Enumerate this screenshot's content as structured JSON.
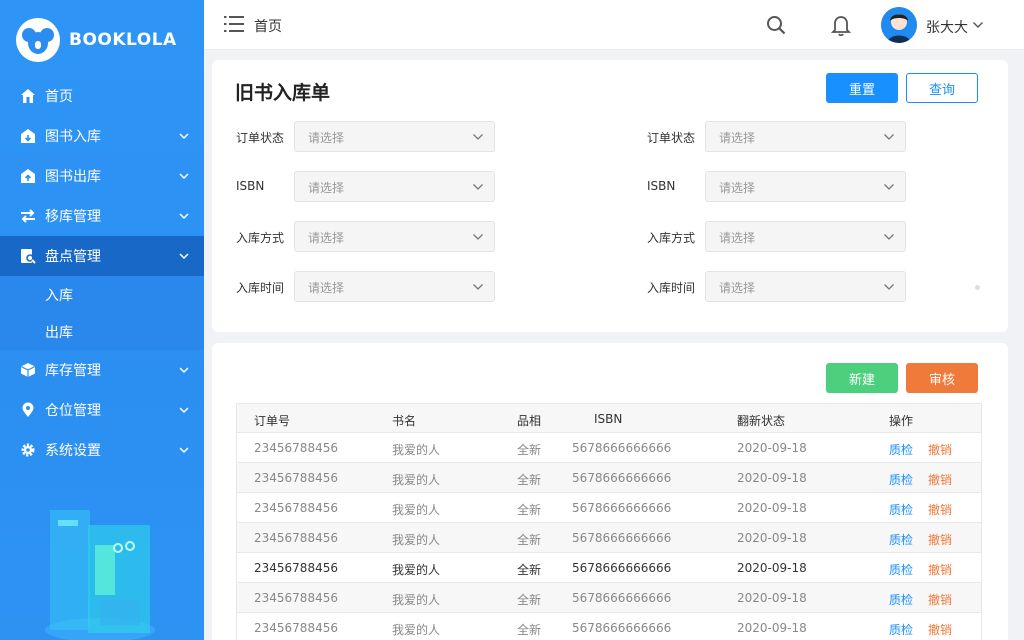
{
  "app": {
    "logo_text": "BOOKLOLA"
  },
  "sidebar": {
    "items": [
      {
        "label": "首页",
        "icon": "home-icon"
      },
      {
        "label": "图书入库",
        "icon": "inbound-icon"
      },
      {
        "label": "图书出库",
        "icon": "outbound-icon"
      },
      {
        "label": "移库管理",
        "icon": "transfer-icon"
      },
      {
        "label": "盘点管理",
        "icon": "inventory-check-icon",
        "active": true
      },
      {
        "label": "库存管理",
        "icon": "box-icon"
      },
      {
        "label": "仓位管理",
        "icon": "location-icon"
      },
      {
        "label": "系统设置",
        "icon": "gear-icon"
      }
    ],
    "submenu": [
      {
        "label": "入库"
      },
      {
        "label": "出库"
      }
    ]
  },
  "topbar": {
    "breadcrumb": "首页",
    "username": "张大大"
  },
  "filter": {
    "title": "旧书入库单",
    "reset_label": "重置",
    "query_label": "查询",
    "fields_left": [
      {
        "label": "订单状态",
        "placeholder": "请选择"
      },
      {
        "label": "ISBN",
        "placeholder": "请选择"
      },
      {
        "label": "入库方式",
        "placeholder": "请选择"
      },
      {
        "label": "入库时间",
        "placeholder": "请选择"
      }
    ],
    "fields_right": [
      {
        "label": "订单状态",
        "placeholder": "请选择"
      },
      {
        "label": "ISBN",
        "placeholder": "请选择"
      },
      {
        "label": "入库方式",
        "placeholder": "请选择"
      },
      {
        "label": "入库时间",
        "placeholder": "请选择"
      }
    ]
  },
  "table": {
    "new_label": "新建",
    "audit_label": "审核",
    "columns": [
      "订单号",
      "书名",
      "品相",
      "ISBN",
      "翻新状态",
      "操作"
    ],
    "action_inspect": "质检",
    "action_revoke": "撤销",
    "rows": [
      {
        "order": "23456788456",
        "book": "我爱的人",
        "cond": "全新",
        "isbn": "5678666666666",
        "status": "2020-09-18"
      },
      {
        "order": "23456788456",
        "book": "我爱的人",
        "cond": "全新",
        "isbn": "5678666666666",
        "status": "2020-09-18"
      },
      {
        "order": "23456788456",
        "book": "我爱的人",
        "cond": "全新",
        "isbn": "5678666666666",
        "status": "2020-09-18"
      },
      {
        "order": "23456788456",
        "book": "我爱的人",
        "cond": "全新",
        "isbn": "5678666666666",
        "status": "2020-09-18"
      },
      {
        "order": "23456788456",
        "book": "我爱的人",
        "cond": "全新",
        "isbn": "5678666666666",
        "status": "2020-09-18"
      },
      {
        "order": "23456788456",
        "book": "我爱的人",
        "cond": "全新",
        "isbn": "5678666666666",
        "status": "2020-09-18"
      },
      {
        "order": "23456788456",
        "book": "我爱的人",
        "cond": "全新",
        "isbn": "5678666666666",
        "status": "2020-09-18"
      }
    ]
  },
  "colors": {
    "primary": "#1890ff",
    "sidebar": "#2c8ff2",
    "sidebar_active": "#1868c8",
    "success": "#4cd07d",
    "warning": "#f07a3a"
  }
}
